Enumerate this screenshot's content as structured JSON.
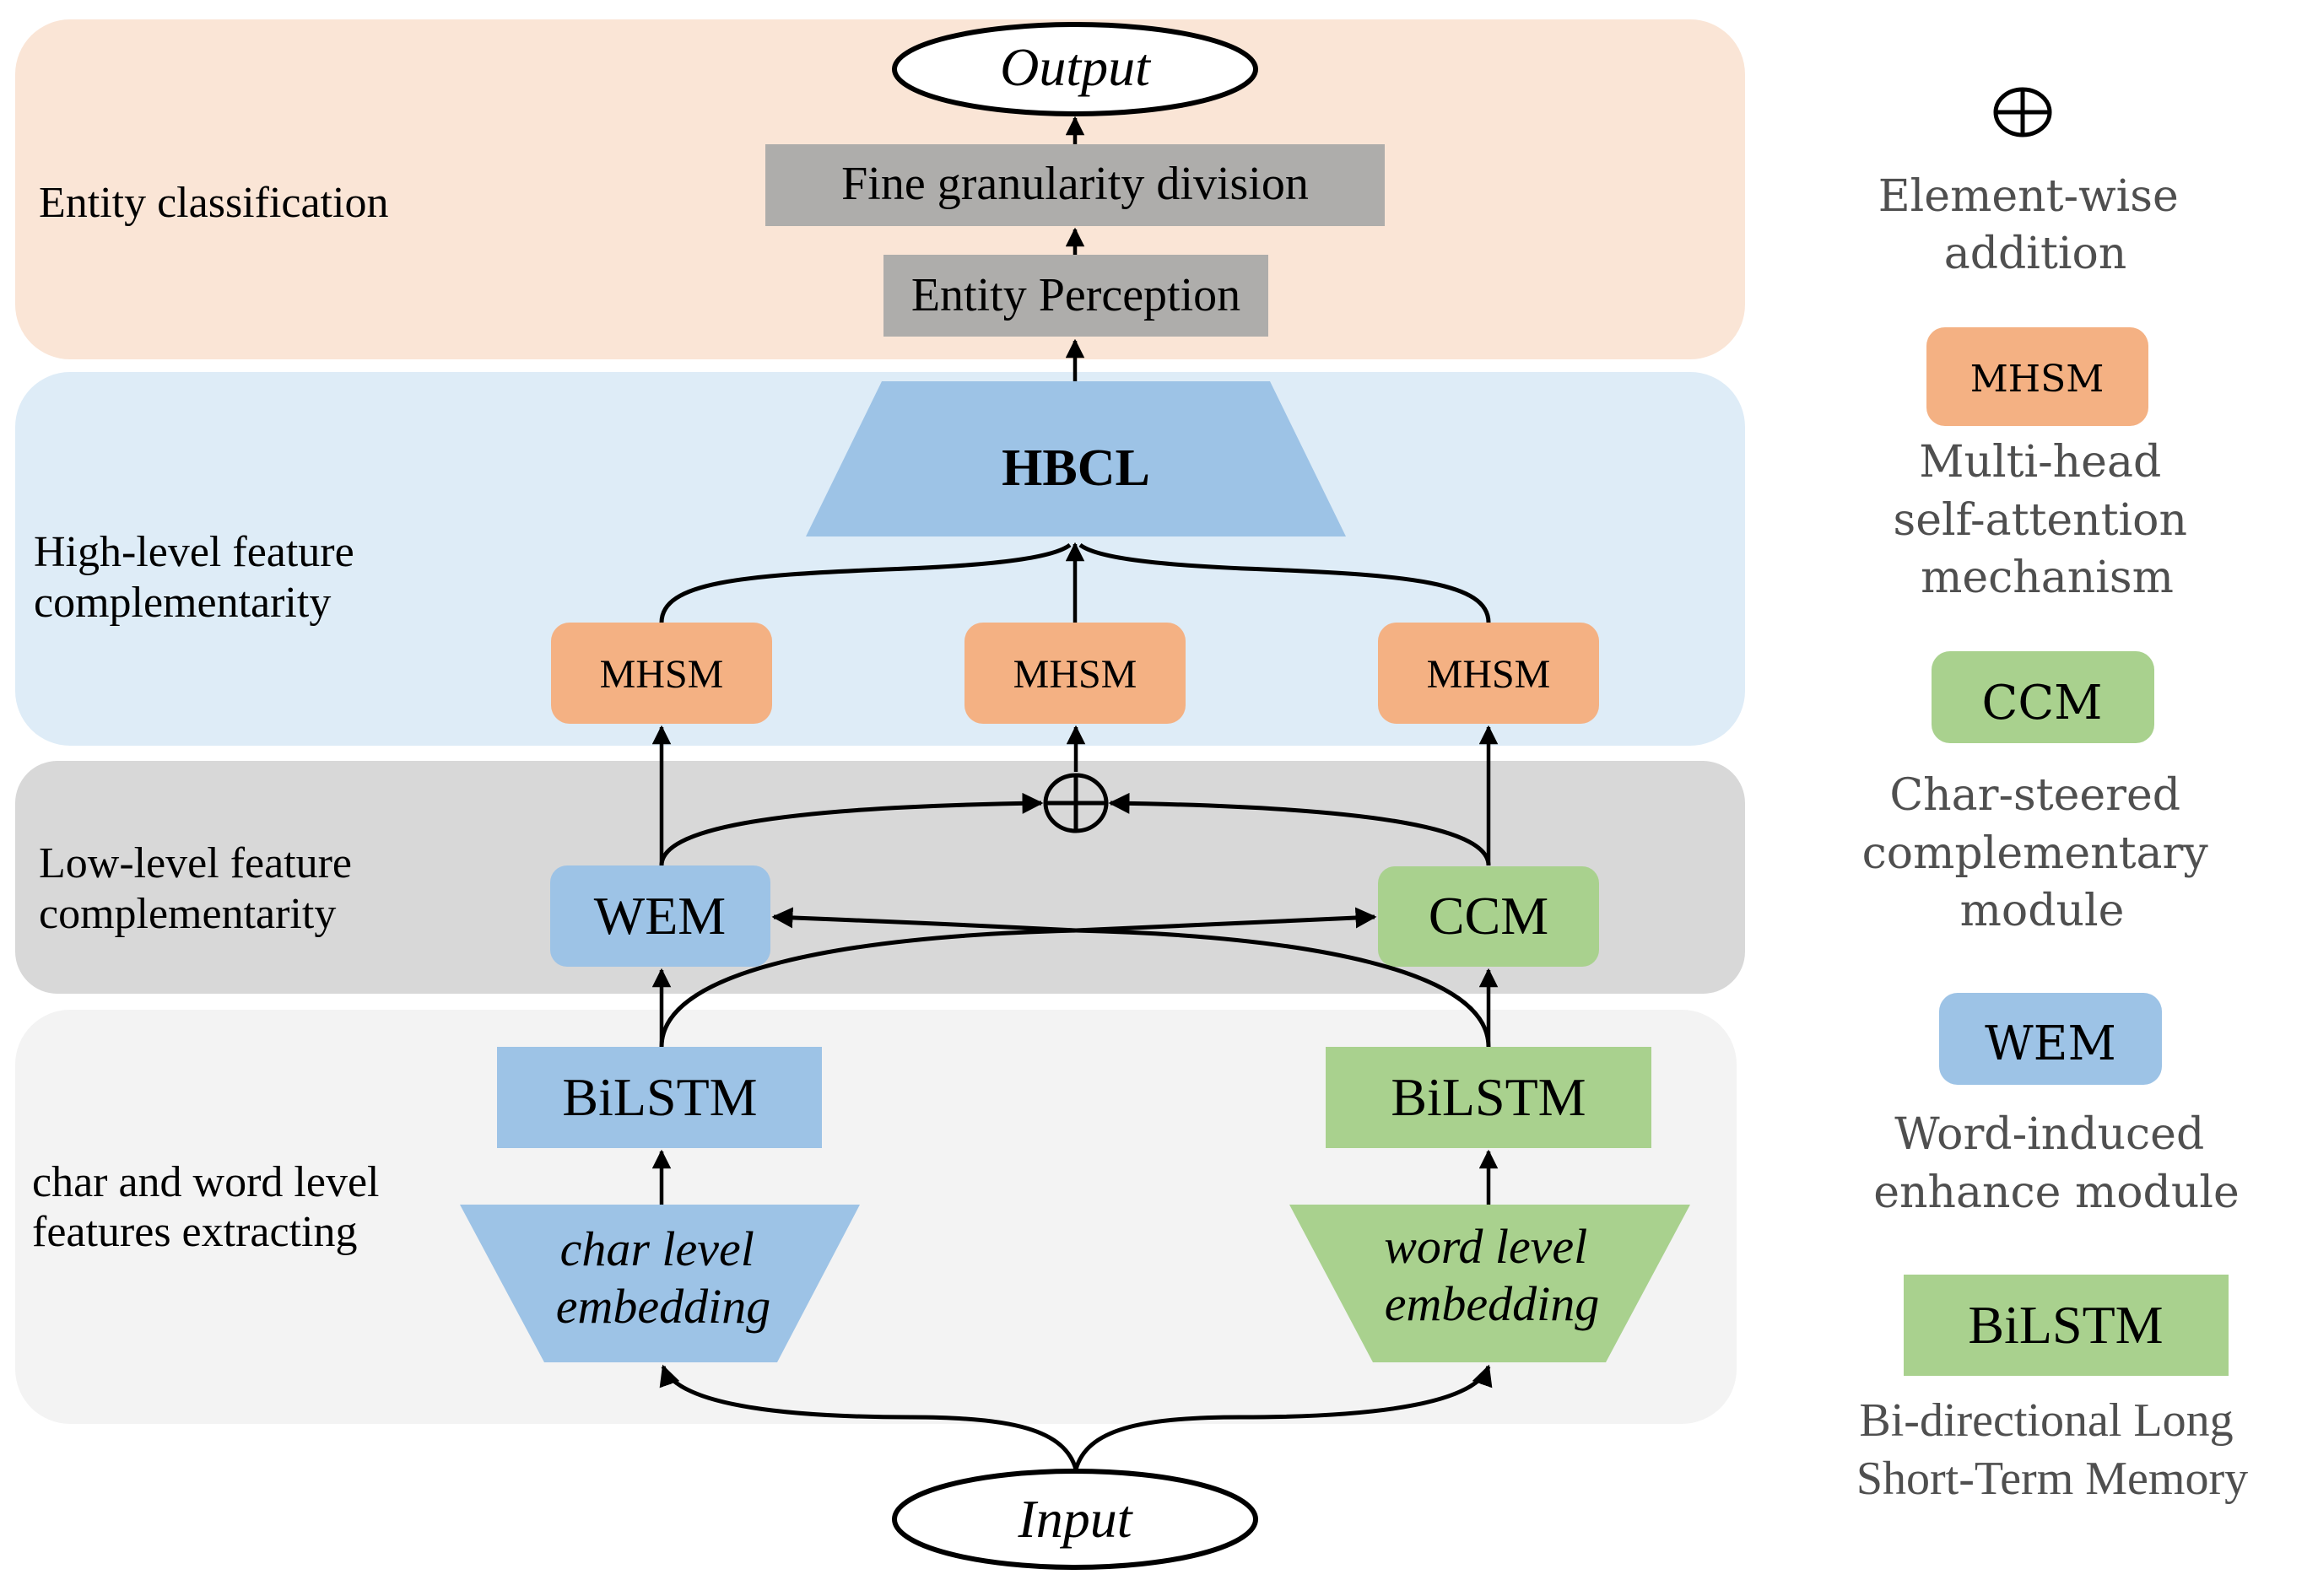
{
  "colors": {
    "panel_entity": "#FAE5D6",
    "panel_high": "#DEECF7",
    "panel_low": "#D8D8D8",
    "panel_extract": "#F3F3F3",
    "gray_box": "#AEADAB",
    "blue": "#9DC3E6",
    "green": "#A9D18E",
    "orange": "#F4B183",
    "legend_text": "#4F4F4F"
  },
  "panels": [
    {
      "id": "entity",
      "label_lines": [
        "Entity classification"
      ]
    },
    {
      "id": "high",
      "label_lines": [
        "High-level feature",
        "complementarity"
      ]
    },
    {
      "id": "low",
      "label_lines": [
        "Low-level feature",
        "complementarity"
      ]
    },
    {
      "id": "extract",
      "label_lines": [
        "char and word level",
        "features extracting"
      ]
    }
  ],
  "nodes": {
    "output": "Output",
    "fine_division": "Fine granularity division",
    "entity_perception": "Entity Perception",
    "hbcl": "HBCL",
    "mhsm_left": "MHSM",
    "mhsm_center": "MHSM",
    "mhsm_right": "MHSM",
    "add_symbol": "element-wise-addition",
    "wem": "WEM",
    "ccm": "CCM",
    "bilstm_char": "BiLSTM",
    "bilstm_word": "BiLSTM",
    "char_embedding": [
      "char level",
      "embedding"
    ],
    "word_embedding": [
      "word level",
      "embedding"
    ],
    "input": "Input"
  },
  "legend": [
    {
      "symbol": "circle-plus",
      "label": "",
      "desc_lines": [
        "Element-wise",
        "addition"
      ]
    },
    {
      "symbol": "rounded-box",
      "color": "#F4B183",
      "label": "MHSM",
      "desc_lines": [
        "Multi-head",
        "self-attention",
        "mechanism"
      ]
    },
    {
      "symbol": "rounded-box",
      "color": "#A9D18E",
      "label": "CCM",
      "desc_lines": [
        "Char-steered",
        "complementary",
        "module"
      ]
    },
    {
      "symbol": "rounded-box",
      "color": "#9DC3E6",
      "label": "WEM",
      "desc_lines": [
        "Word-induced",
        "enhance module"
      ]
    },
    {
      "symbol": "box",
      "color": "#A9D18E",
      "label": "BiLSTM",
      "desc_lines": [
        "Bi-directional Long",
        "Short-Term Memory"
      ]
    }
  ]
}
